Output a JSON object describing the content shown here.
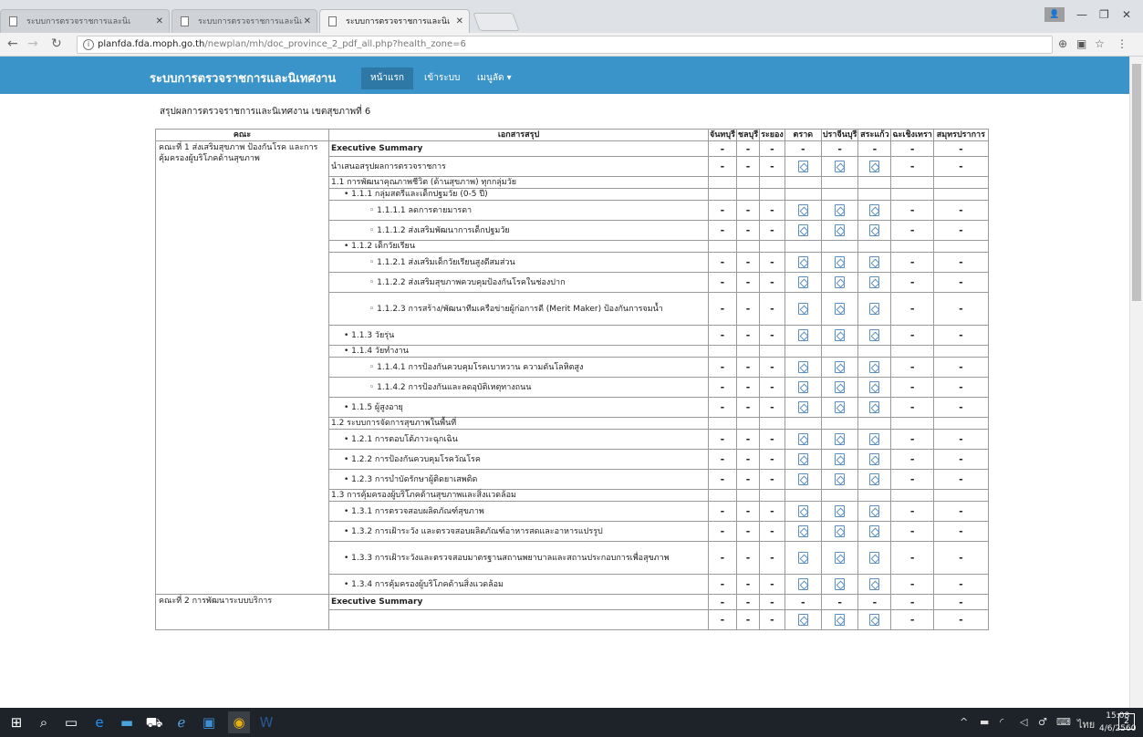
{
  "browser": {
    "tabs": [
      {
        "title": "ระบบการตรวจราชการและนิเ",
        "active": false
      },
      {
        "title": "ระบบการตรวจราชการและนิเ",
        "active": false
      },
      {
        "title": "ระบบการตรวจราชการและนิเ",
        "active": true
      }
    ],
    "url": {
      "host": "planfda.fda.moph.go.th",
      "path": "/newplan/mh/doc_province_2_pdf_all.php?health_zone=6"
    }
  },
  "site": {
    "brand": "ระบบการตรวจราชการและนิเทศงาน",
    "nav": [
      {
        "label": "หน้าแรก",
        "active": true
      },
      {
        "label": "เข้าระบบ",
        "active": false
      },
      {
        "label": "เมนูลัด ▾",
        "active": false
      }
    ]
  },
  "page": {
    "title": "สรุปผลการตรวจราชการและนิเทศงาน เขตสุขภาพที่ 6"
  },
  "table": {
    "headers": [
      "คณะ",
      "เอกสารสรุป",
      "จันทบุรี",
      "ชลบุรี",
      "ระยอง",
      "ตราด",
      "ปราจีนบุรี",
      "สระแก้ว",
      "ฉะเชิงเทรา",
      "สมุทรปราการ"
    ],
    "groups": [
      {
        "name": "คณะที่ 1 ส่งเสริมสุขภาพ ป้องกันโรค และการคุ้มครองผู้บริโภคด้านสุขภาพ"
      },
      {
        "name": "คณะที่ 2 การพัฒนาระบบบริการ"
      }
    ],
    "rows": [
      {
        "group": 0,
        "label": "Executive Summary",
        "level": 0,
        "kind": "exec"
      },
      {
        "group": 0,
        "label": "นำเสนอสรุปผลการตรวจราชการ",
        "level": 0,
        "kind": "data"
      },
      {
        "group": 0,
        "label": "1.1 การพัฒนาคุณภาพชีวิต (ด้านสุขภาพ) ทุกกลุ่มวัย",
        "level": 0,
        "kind": "section"
      },
      {
        "group": 0,
        "label": "1.1.1 กลุ่มสตรีและเด็กปฐมวัย (0-5 ปี)",
        "level": 1,
        "kind": "section"
      },
      {
        "group": 0,
        "label": "1.1.1.1 ลดการตายมารดา",
        "level": 2,
        "kind": "data"
      },
      {
        "group": 0,
        "label": "1.1.1.2 ส่งเสริมพัฒนาการเด็กปฐมวัย",
        "level": 2,
        "kind": "data"
      },
      {
        "group": 0,
        "label": "1.1.2 เด็กวัยเรียน",
        "level": 1,
        "kind": "section"
      },
      {
        "group": 0,
        "label": "1.1.2.1 ส่งเสริมเด็กวัยเรียนสูงดีสมส่วน",
        "level": 2,
        "kind": "data"
      },
      {
        "group": 0,
        "label": "1.1.2.2 ส่งเสริมสุขภาพควบคุมป้องกันโรคในช่องปาก",
        "level": 2,
        "kind": "data"
      },
      {
        "group": 0,
        "label": "1.1.2.3 การสร้าง/พัฒนาทีมเครือข่ายผู้ก่อการดี (Merit Maker) ป้องกันการจมน้ำ",
        "level": 2,
        "kind": "data"
      },
      {
        "group": 0,
        "label": "1.1.3 วัยรุ่น",
        "level": 1,
        "kind": "data"
      },
      {
        "group": 0,
        "label": "1.1.4 วัยทำงาน",
        "level": 1,
        "kind": "section"
      },
      {
        "group": 0,
        "label": "1.1.4.1 การป้องกันควบคุมโรคเบาหวาน ความดันโลหิตสูง",
        "level": 2,
        "kind": "data"
      },
      {
        "group": 0,
        "label": "1.1.4.2 การป้องกันและลดอุบัติเหตุทางถนน",
        "level": 2,
        "kind": "data"
      },
      {
        "group": 0,
        "label": "1.1.5 ผู้สูงอายุ",
        "level": 1,
        "kind": "data"
      },
      {
        "group": 0,
        "label": "1.2 ระบบการจัดการสุขภาพในพื้นที่",
        "level": 0,
        "kind": "section"
      },
      {
        "group": 0,
        "label": "1.2.1 การตอบโต้ภาวะฉุกเฉิน",
        "level": 1,
        "kind": "data"
      },
      {
        "group": 0,
        "label": "1.2.2 การป้องกันควบคุมโรควัณโรค",
        "level": 1,
        "kind": "data"
      },
      {
        "group": 0,
        "label": "1.2.3 การบำบัดรักษาผู้ติดยาเสพติด",
        "level": 1,
        "kind": "data"
      },
      {
        "group": 0,
        "label": "1.3 การคุ้มครองผู้บริโภคด้านสุขภาพและสิ่งแวดล้อม",
        "level": 0,
        "kind": "section"
      },
      {
        "group": 0,
        "label": "1.3.1 การตรวจสอบผลิตภัณฑ์สุขภาพ",
        "level": 1,
        "kind": "data"
      },
      {
        "group": 0,
        "label": "1.3.2 การเฝ้าระวัง และตรวจสอบผลิตภัณฑ์อาหารสดและอาหารแปรรูป",
        "level": 1,
        "kind": "data"
      },
      {
        "group": 0,
        "label": "1.3.3 การเฝ้าระวังและตรวจสอบมาตรฐานสถานพยาบาลและสถานประกอบการเพื่อสุขภาพ",
        "level": 1,
        "kind": "data"
      },
      {
        "group": 0,
        "label": "1.3.4 การคุ้มครองผู้บริโภคด้านสิ่งแวดล้อม",
        "level": 1,
        "kind": "data"
      },
      {
        "group": 1,
        "label": "Executive Summary",
        "level": 0,
        "kind": "exec"
      },
      {
        "group": 1,
        "label": "",
        "level": 0,
        "kind": "data"
      }
    ],
    "cell_symbols": {
      "dash": "-"
    }
  },
  "taskbar": {
    "language": "ไทย",
    "time": "15:08",
    "date": "4/6/2560",
    "notifications": "2"
  }
}
